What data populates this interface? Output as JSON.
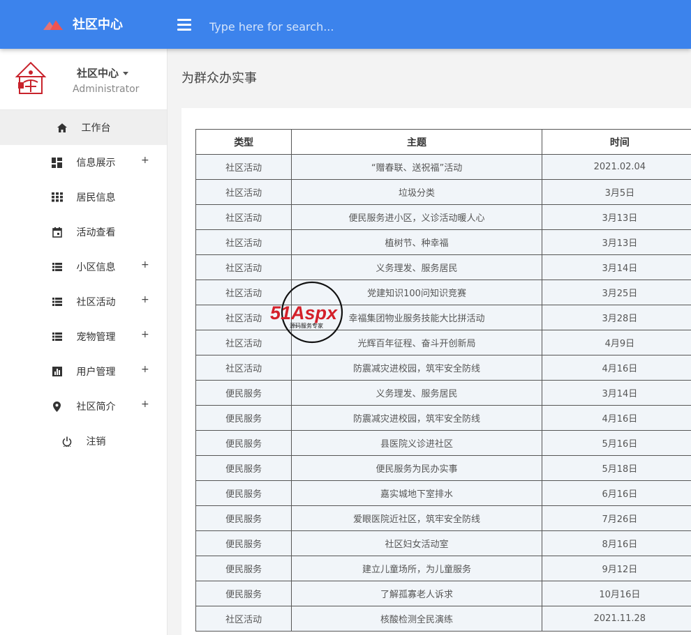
{
  "header": {
    "brand": "社区中心",
    "search_placeholder": "Type here for search..."
  },
  "profile": {
    "name": "社区中心",
    "role": "Administrator"
  },
  "sidebar": {
    "items": [
      {
        "label": "工作台",
        "icon": "home-icon",
        "expandable": false
      },
      {
        "label": "信息展示",
        "icon": "dashboard-icon",
        "expandable": true
      },
      {
        "label": "居民信息",
        "icon": "grid-icon",
        "expandable": false
      },
      {
        "label": "活动查看",
        "icon": "calendar-icon",
        "expandable": false
      },
      {
        "label": "小区信息",
        "icon": "list-icon",
        "expandable": true
      },
      {
        "label": "社区活动",
        "icon": "list-icon",
        "expandable": true
      },
      {
        "label": "宠物管理",
        "icon": "list-icon",
        "expandable": true
      },
      {
        "label": "用户管理",
        "icon": "chart-icon",
        "expandable": true
      },
      {
        "label": "社区简介",
        "icon": "location-pin-icon",
        "expandable": true
      },
      {
        "label": "注销",
        "icon": "power-icon",
        "expandable": false
      }
    ],
    "plus": "+"
  },
  "main": {
    "title": "为群众办实事",
    "table": {
      "headers": [
        "类型",
        "主题",
        "时间"
      ],
      "rows": [
        [
          "社区活动",
          "“赠春联、送祝福”活动",
          "2021.02.04"
        ],
        [
          "社区活动",
          "垃圾分类",
          "3月5日"
        ],
        [
          "社区活动",
          "便民服务进小区，义诊活动暖人心",
          "3月13日"
        ],
        [
          "社区活动",
          "植树节、种幸福",
          "3月13日"
        ],
        [
          "社区活动",
          "义务理发、服务居民",
          "3月14日"
        ],
        [
          "社区活动",
          "党建知识100问知识竞赛",
          "3月25日"
        ],
        [
          "社区活动",
          "幸福集团物业服务技能大比拼活动",
          "3月28日"
        ],
        [
          "社区活动",
          "光辉百年征程、奋斗开创新局",
          "4月9日"
        ],
        [
          "社区活动",
          "防震减灾进校园，筑牢安全防线",
          "4月16日"
        ],
        [
          "便民服务",
          "义务理发、服务居民",
          "3月14日"
        ],
        [
          "便民服务",
          "防震减灾进校园，筑牢安全防线",
          "4月16日"
        ],
        [
          "便民服务",
          "县医院义诊进社区",
          "5月16日"
        ],
        [
          "便民服务",
          "便民服务为民办实事",
          "5月18日"
        ],
        [
          "便民服务",
          "嘉实城地下室排水",
          "6月16日"
        ],
        [
          "便民服务",
          "爱眼医院近社区，筑牢安全防线",
          "7月26日"
        ],
        [
          "便民服务",
          "社区妇女活动室",
          "8月16日"
        ],
        [
          "便民服务",
          "建立儿童场所，为儿童服务",
          "9月12日"
        ],
        [
          "便民服务",
          "了解孤寡老人诉求",
          "10月16日"
        ],
        [
          "社区活动",
          "核酸检测全民演练",
          "2021.11.28"
        ]
      ]
    }
  },
  "watermark": {
    "text": "51Aspx",
    "subtext": "源码服务专家"
  },
  "colors": {
    "topbar": "#3c83ec",
    "row_bg": "#f1f5f9",
    "logo_red": "#c8232c"
  }
}
